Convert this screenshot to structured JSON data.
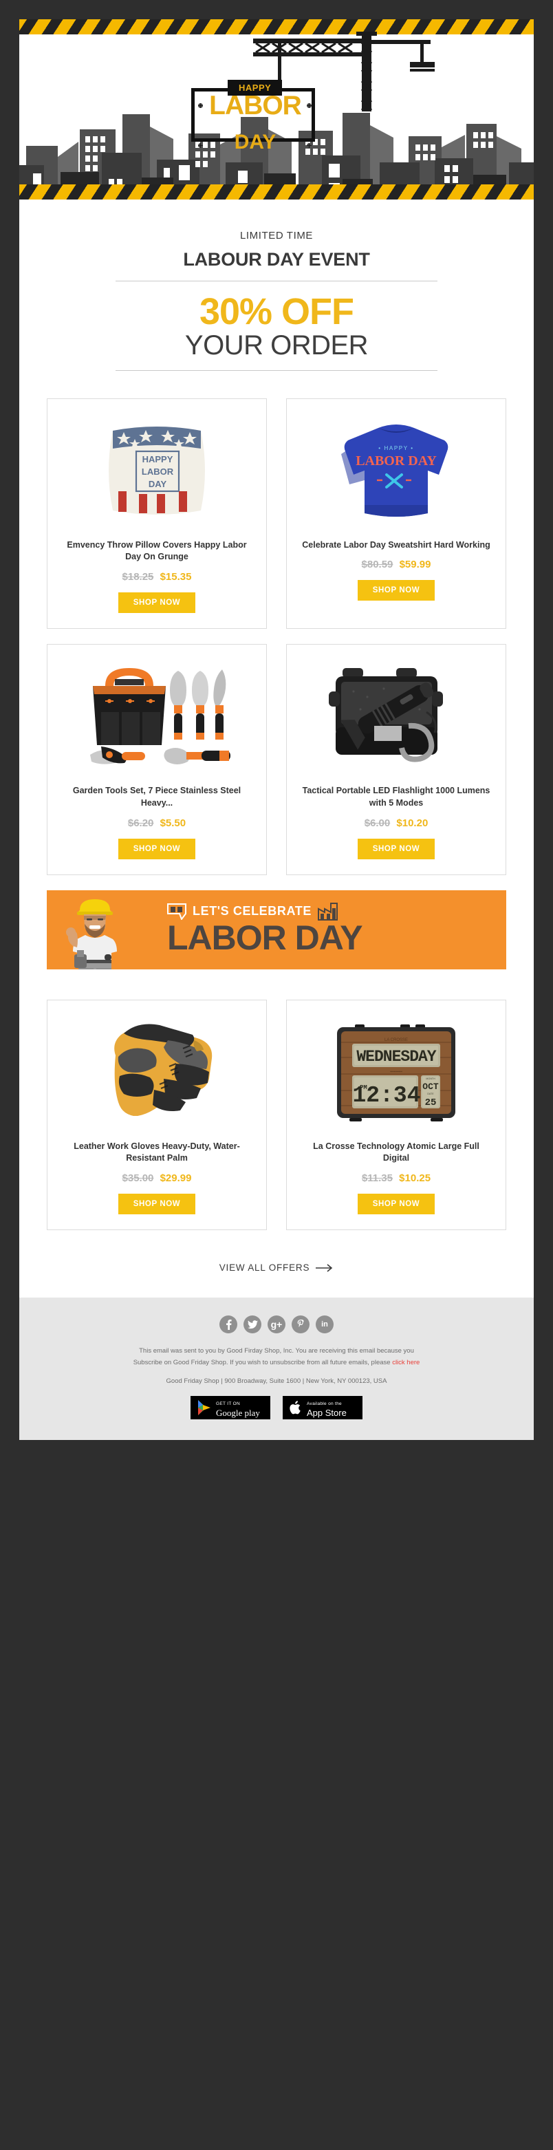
{
  "colors": {
    "brand_yellow": "#f0b71b",
    "button_yellow": "#f5c211",
    "sign_gold": "#e8ac16",
    "banner_orange": "#f4902c",
    "dark_text": "#3a3a3a",
    "page_bg": "#2e2e2e",
    "footer_bg": "#e6e6e6",
    "link_red": "#e8413b",
    "old_price_gray": "#b6b6b6"
  },
  "hero": {
    "sign_top": "HAPPY",
    "sign_main": "LABOR",
    "sign_sub": "DAY",
    "crane_icon": "construction-crane-icon",
    "hazard_icon": "hazard-stripe-icon",
    "skyline_icon": "city-skyline-icon"
  },
  "headline": {
    "eyebrow": "LIMITED TIME",
    "title": "LABOUR DAY EVENT",
    "discount": "30% OFF",
    "subtitle": "YOUR ORDER"
  },
  "products": [
    {
      "title": "Emvency Throw Pillow Covers Happy Labor Day On Grunge",
      "old_price": "$18.25",
      "new_price": "$15.35",
      "cta": "SHOP NOW",
      "image": "throw-pillow-usa-flag-image"
    },
    {
      "title": "Celebrate Labor Day Sweatshirt Hard Working",
      "old_price": "$80.59",
      "new_price": "$59.99",
      "cta": "SHOP NOW",
      "image": "blue-sweatshirt-image"
    },
    {
      "title": "Garden Tools Set, 7 Piece Stainless Steel Heavy...",
      "old_price": "$6.20",
      "new_price": "$5.50",
      "cta": "SHOP NOW",
      "image": "garden-tools-set-image"
    },
    {
      "title": "Tactical Portable LED Flashlight 1000 Lumens with 5 Modes",
      "old_price": "$6.00",
      "new_price": "$10.20",
      "cta": "SHOP NOW",
      "image": "led-flashlight-case-image"
    },
    {
      "title": "Leather Work Gloves Heavy-Duty, Water-Resistant Palm",
      "old_price": "$35.00",
      "new_price": "$29.99",
      "cta": "SHOP NOW",
      "image": "leather-work-gloves-image"
    },
    {
      "title": "La Crosse Technology Atomic Large Full Digital",
      "old_price": "$11.35",
      "new_price": "$10.25",
      "cta": "SHOP NOW",
      "image": "digital-wall-clock-image"
    }
  ],
  "celebrate_banner": {
    "line1": "LET'S CELEBRATE",
    "line2": "LABOR DAY",
    "worker_icon": "construction-worker-icon",
    "left_icon": "quote-mark-icon",
    "right_icon": "factory-icon"
  },
  "view_all": {
    "label": "VIEW ALL OFFERS",
    "arrow": "→"
  },
  "footer": {
    "social": [
      {
        "name": "facebook",
        "glyph": "f"
      },
      {
        "name": "twitter",
        "glyph": "🐦"
      },
      {
        "name": "google-plus",
        "glyph": "g+"
      },
      {
        "name": "pinterest",
        "glyph": "℘"
      },
      {
        "name": "linkedin",
        "glyph": "in"
      }
    ],
    "legal_1": "This email was sent to you by Good Firday Shop, Inc. You are receiving this email because you",
    "legal_2": "Subscribe on Good Friday Shop. If you wish to unsubscribe from all future emails, please ",
    "legal_link": "click here",
    "address": "Good Friday Shop | 900 Broadway, Suite 1600 | New York, NY 000123, USA",
    "google_play": {
      "small": "GET IT ON",
      "big": "Google play"
    },
    "app_store": {
      "small": "Available on the",
      "big": "App Store"
    }
  }
}
